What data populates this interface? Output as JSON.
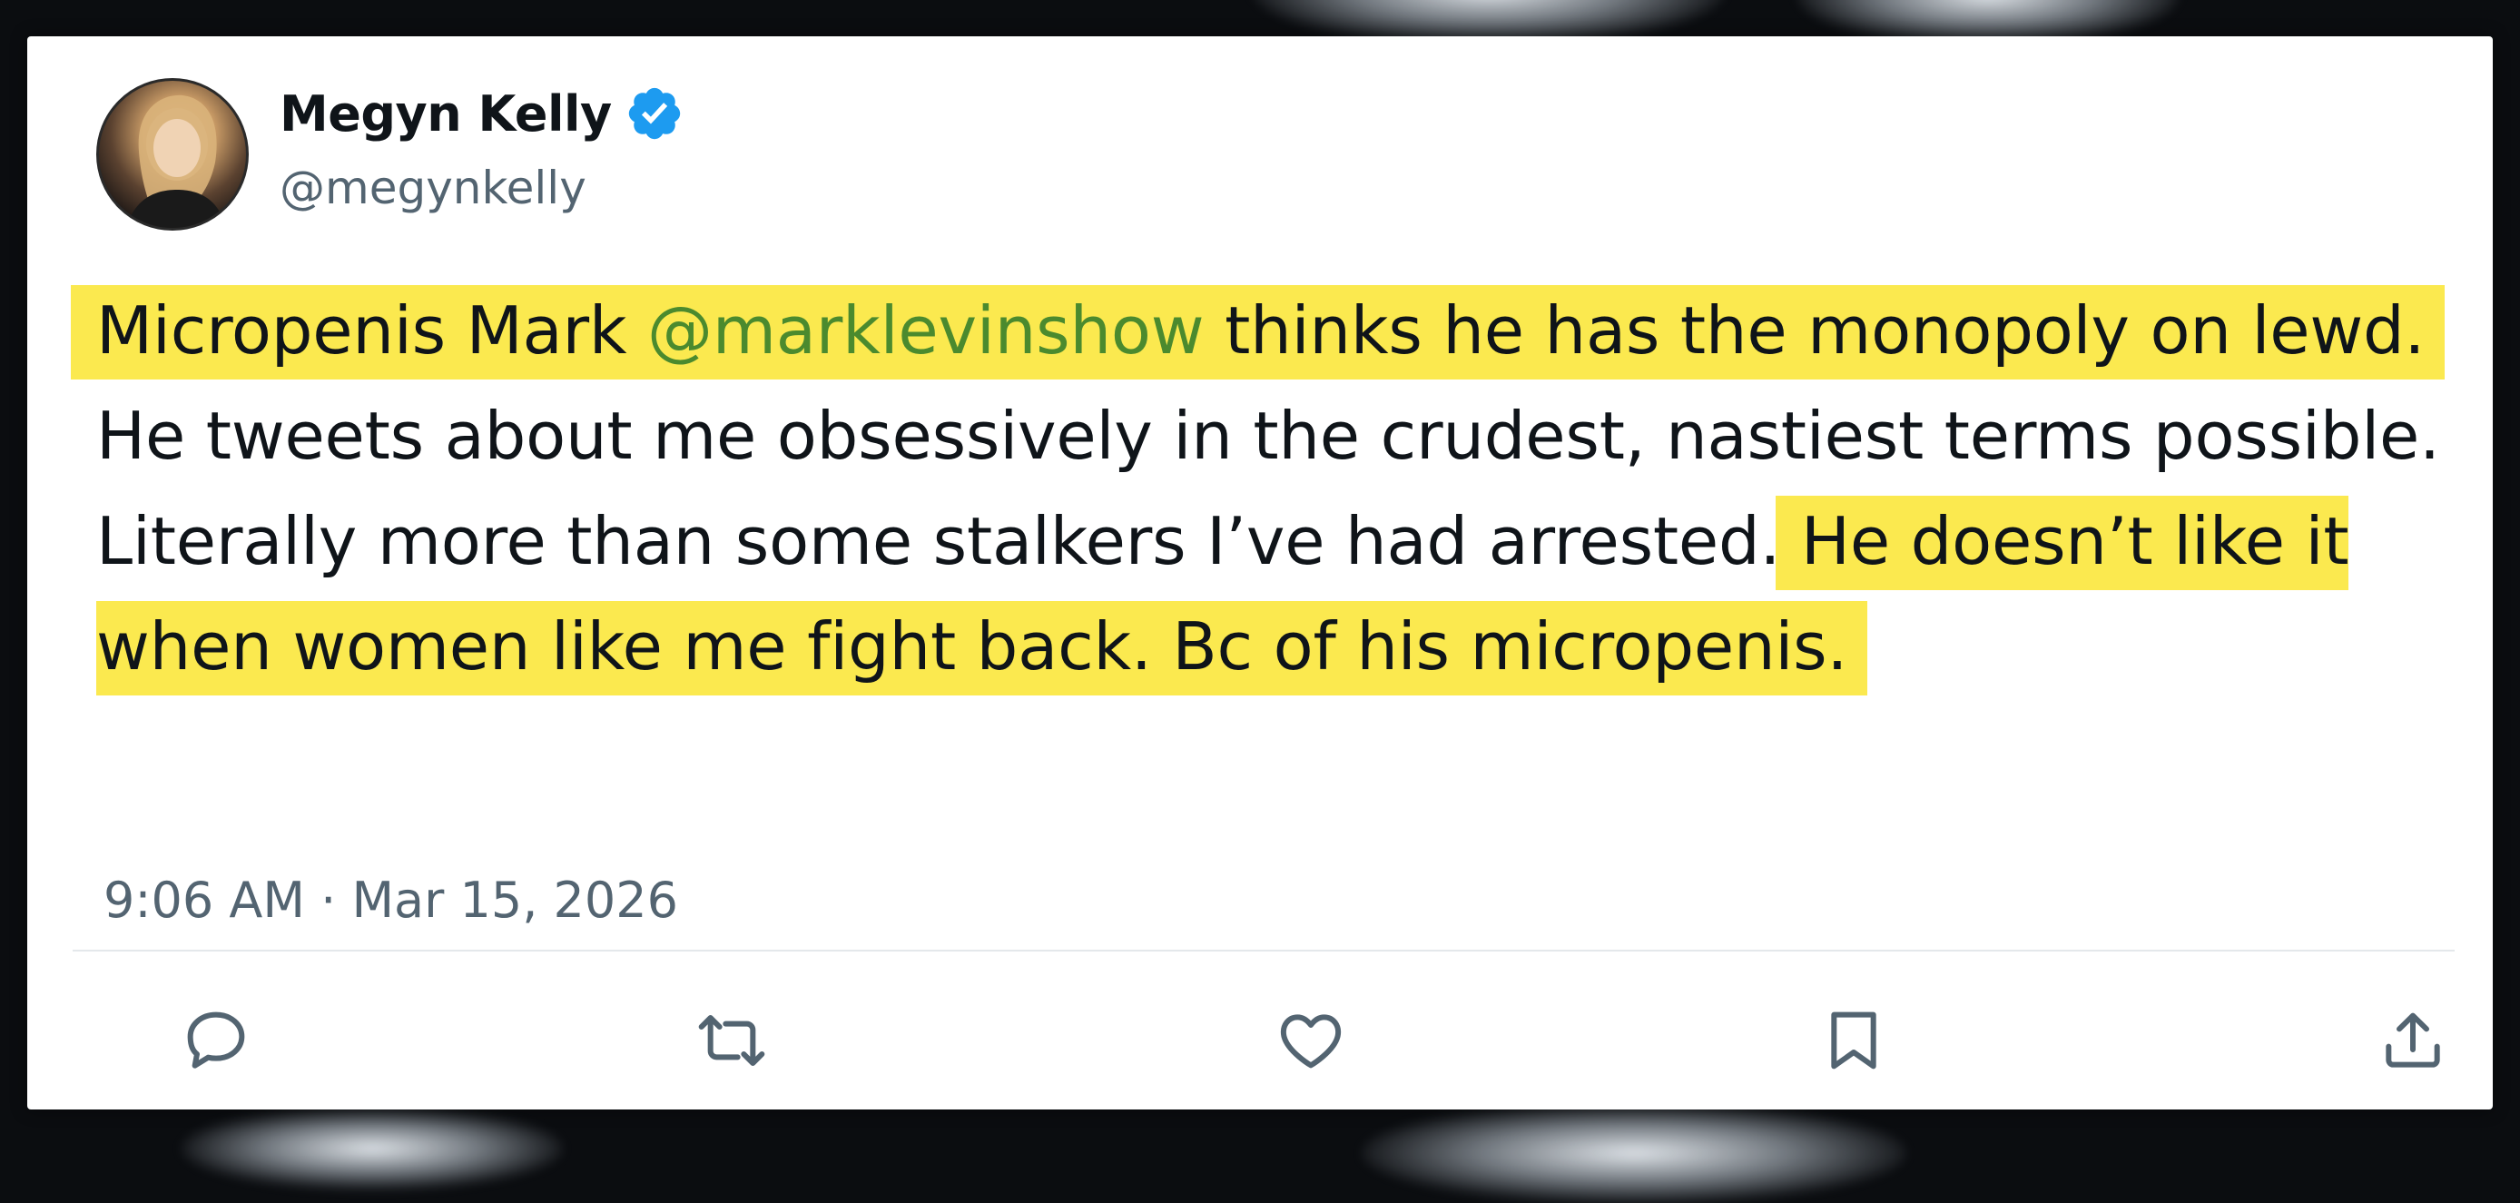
{
  "tweet": {
    "author": {
      "name": "Megyn Kelly",
      "handle": "@megynkelly",
      "verified": true,
      "avatar_icon": "profile-photo"
    },
    "text": {
      "p1": "Micropenis Mark",
      "mention": "@marklevinshow",
      "p2": "thinks he has the monopoly",
      "p3": "on lewd.",
      "p4": "He tweets about me obsessively in the crudest, nastiest terms possible. Literally more than some stalkers I’ve had arrested.",
      "p5": "He doesn’t like it when women like me fight back. Bc of",
      "p6": "his micropenis."
    },
    "timestamp": "9:06 AM · Mar 15, 2026",
    "actions": [
      {
        "name": "reply",
        "icon": "reply-icon"
      },
      {
        "name": "retweet",
        "icon": "retweet-icon"
      },
      {
        "name": "like",
        "icon": "heart-icon"
      },
      {
        "name": "bookmark",
        "icon": "bookmark-icon"
      },
      {
        "name": "share",
        "icon": "share-icon"
      }
    ]
  },
  "colors": {
    "highlight": "#fbe94f",
    "mention": "#4b8a2e",
    "verified_badge": "#1d9bf0",
    "secondary_text": "#536471",
    "primary_text": "#0f1419"
  }
}
